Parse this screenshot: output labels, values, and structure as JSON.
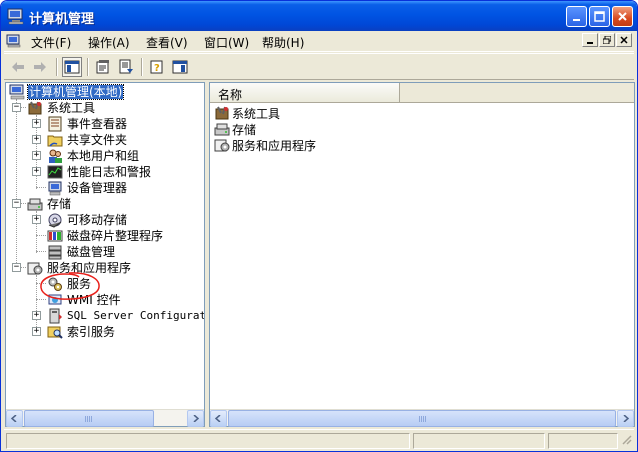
{
  "window": {
    "title": "计算机管理"
  },
  "menu": [
    {
      "label": "文件(F)"
    },
    {
      "label": "操作(A)"
    },
    {
      "label": "查看(V)"
    },
    {
      "label": "窗口(W)"
    },
    {
      "label": "帮助(H)"
    }
  ],
  "toolbar": {
    "icons": [
      "back-arrow-icon",
      "forward-arrow-icon",
      "show-hide-tree-icon",
      "properties-icon",
      "export-list-icon",
      "help-icon",
      "show-hide-action-pane-icon"
    ]
  },
  "tree": {
    "root": "计算机管理(本地)",
    "nodes": [
      {
        "label": "系统工具",
        "icon": "tools-icon"
      },
      {
        "label": "事件查看器",
        "icon": "event-viewer-icon"
      },
      {
        "label": "共享文件夹",
        "icon": "shared-folder-icon"
      },
      {
        "label": "本地用户和组",
        "icon": "users-icon"
      },
      {
        "label": "性能日志和警报",
        "icon": "performance-icon"
      },
      {
        "label": "设备管理器",
        "icon": "device-manager-icon"
      },
      {
        "label": "存储",
        "icon": "storage-icon"
      },
      {
        "label": "可移动存储",
        "icon": "removable-storage-icon"
      },
      {
        "label": "磁盘碎片整理程序",
        "icon": "defrag-icon"
      },
      {
        "label": "磁盘管理",
        "icon": "disk-management-icon"
      },
      {
        "label": "服务和应用程序",
        "icon": "services-apps-icon"
      },
      {
        "label": "服务",
        "icon": "services-icon"
      },
      {
        "label": "WMI 控件",
        "icon": "wmi-icon"
      },
      {
        "label": "SQL Server Configuratio",
        "icon": "sql-server-icon"
      },
      {
        "label": "索引服务",
        "icon": "indexing-icon"
      }
    ]
  },
  "list": {
    "column_header": "名称",
    "items": [
      {
        "label": "系统工具",
        "icon": "tools-icon"
      },
      {
        "label": "存储",
        "icon": "storage-icon"
      },
      {
        "label": "服务和应用程序",
        "icon": "services-apps-icon"
      }
    ]
  },
  "colors": {
    "title_bar": "#0054e3",
    "selection": "#316ac5",
    "annotation": "#e8201a"
  }
}
